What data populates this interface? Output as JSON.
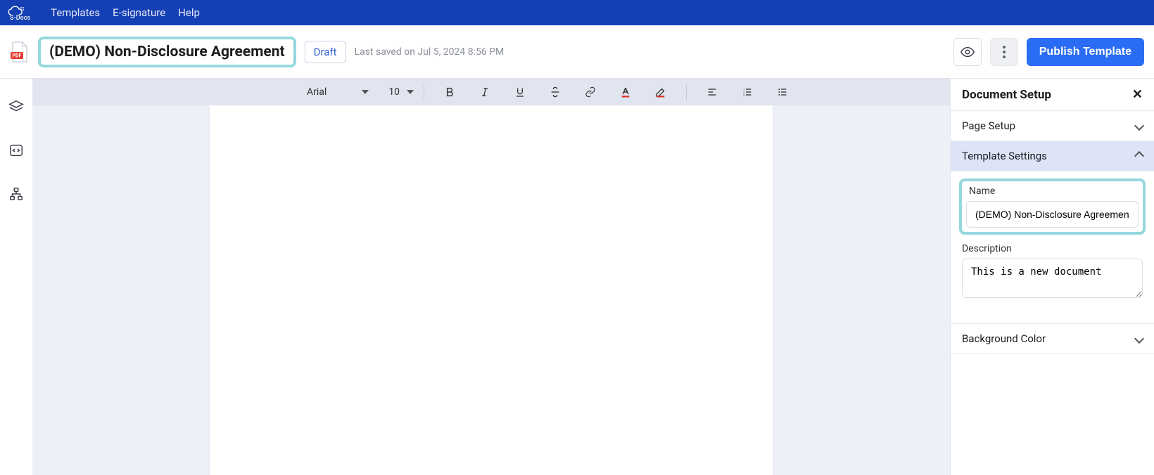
{
  "brand": "S-Docs",
  "nav": {
    "templates": "Templates",
    "esignature": "E-signature",
    "help": "Help"
  },
  "doc": {
    "badge": "PDF",
    "title": "(DEMO) Non-Disclosure Agreement",
    "status": "Draft",
    "saved": "Last saved on Jul 5, 2024 8:56 PM"
  },
  "actions": {
    "publish": "Publish Template"
  },
  "toolbar": {
    "font": "Arial",
    "size": "10"
  },
  "panel": {
    "title": "Document Setup",
    "sections": {
      "pageSetup": "Page Setup",
      "templateSettings": "Template Settings",
      "backgroundColor": "Background Color"
    },
    "fields": {
      "nameLabel": "Name",
      "nameValue": "(DEMO) Non-Disclosure Agreement",
      "descLabel": "Description",
      "descValue": "This is a new document"
    }
  }
}
